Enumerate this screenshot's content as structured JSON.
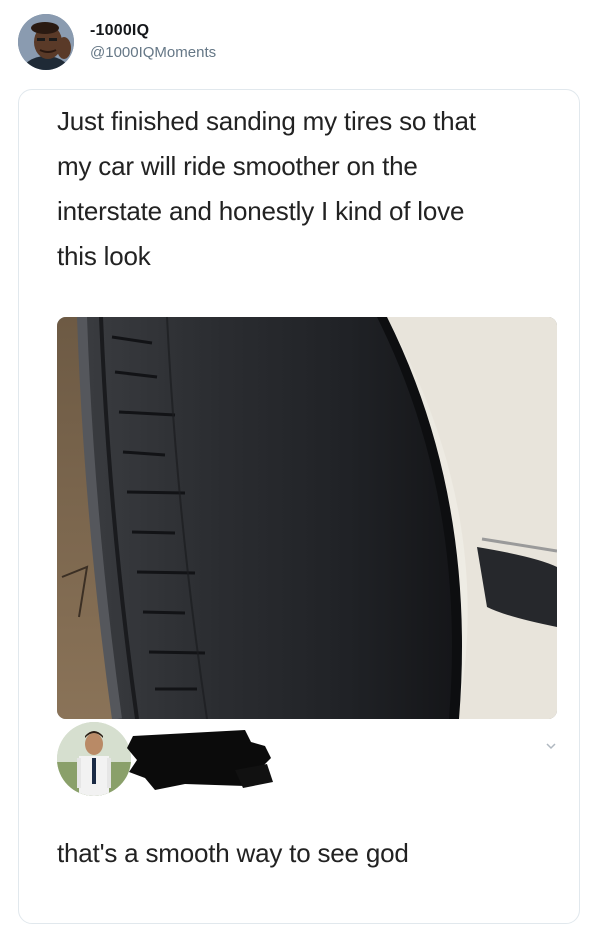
{
  "tweet": {
    "display_name": "-1000IQ",
    "handle": "@1000IQMoments",
    "avatar_icon": "user-avatar"
  },
  "quoted_post": {
    "lines": [
      "Just finished sanding my tires so that",
      "my car will ride smoother on the",
      "interstate and honestly I kind of love",
      "this look"
    ],
    "photo_icon": "tire-photo",
    "reply": {
      "avatar_icon": "user-avatar",
      "name_redacted": true,
      "text": "that's a smooth way to see god"
    }
  },
  "colors": {
    "handle": "#657786",
    "border": "#e1e8ed",
    "text": "#222222"
  }
}
